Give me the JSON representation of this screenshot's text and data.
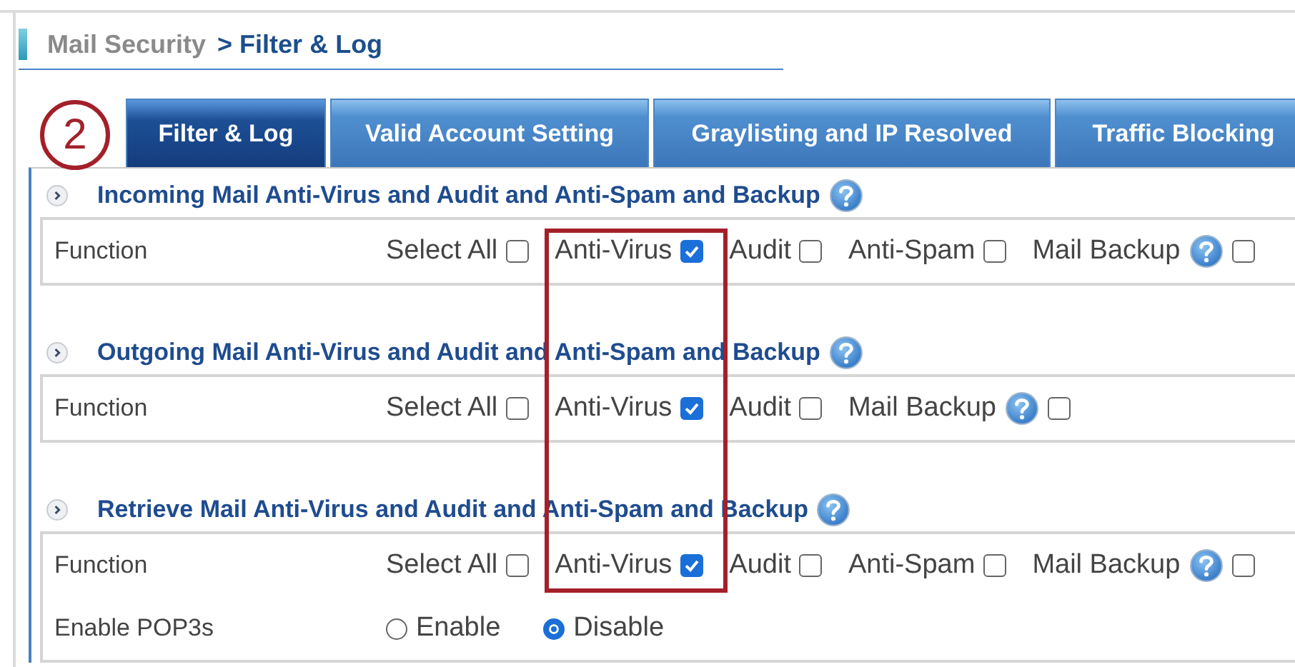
{
  "breadcrumb": {
    "parent": "Mail Security",
    "current": "> Filter & Log"
  },
  "callout": {
    "number": "2"
  },
  "tabs": [
    {
      "label": "Filter & Log",
      "selected": true
    },
    {
      "label": "Valid Account Setting",
      "selected": false
    },
    {
      "label": "Graylisting and IP Resolved",
      "selected": false
    },
    {
      "label": "Traffic Blocking",
      "selected": false
    }
  ],
  "sections": [
    {
      "title": "Incoming Mail Anti-Virus and Audit and Anti-Spam and Backup",
      "rows": [
        {
          "kind": "checkboxes",
          "label": "Function",
          "options": [
            {
              "label": "Select All",
              "checked": false,
              "help": false
            },
            {
              "label": "Anti-Virus",
              "checked": true,
              "help": false
            },
            {
              "label": "Audit",
              "checked": false,
              "help": false
            },
            {
              "label": "Anti-Spam",
              "checked": false,
              "help": false
            },
            {
              "label": "Mail Backup",
              "checked": false,
              "help": true
            }
          ]
        }
      ]
    },
    {
      "title": "Outgoing Mail Anti-Virus and Audit and Anti-Spam and Backup",
      "rows": [
        {
          "kind": "checkboxes",
          "label": "Function",
          "options": [
            {
              "label": "Select All",
              "checked": false,
              "help": false
            },
            {
              "label": "Anti-Virus",
              "checked": true,
              "help": false
            },
            {
              "label": "Audit",
              "checked": false,
              "help": false
            },
            {
              "label": "Mail Backup",
              "checked": false,
              "help": true
            }
          ]
        }
      ]
    },
    {
      "title": "Retrieve Mail Anti-Virus and Audit and Anti-Spam and Backup",
      "rows": [
        {
          "kind": "checkboxes",
          "label": "Function",
          "options": [
            {
              "label": "Select All",
              "checked": false,
              "help": false
            },
            {
              "label": "Anti-Virus",
              "checked": true,
              "help": false
            },
            {
              "label": "Audit",
              "checked": false,
              "help": false
            },
            {
              "label": "Anti-Spam",
              "checked": false,
              "help": false
            },
            {
              "label": "Mail Backup",
              "checked": false,
              "help": true
            }
          ]
        },
        {
          "kind": "radios",
          "label": "Enable POP3s",
          "options": [
            {
              "label": "Enable",
              "selected": false
            },
            {
              "label": "Disable",
              "selected": true
            }
          ]
        }
      ]
    }
  ]
}
